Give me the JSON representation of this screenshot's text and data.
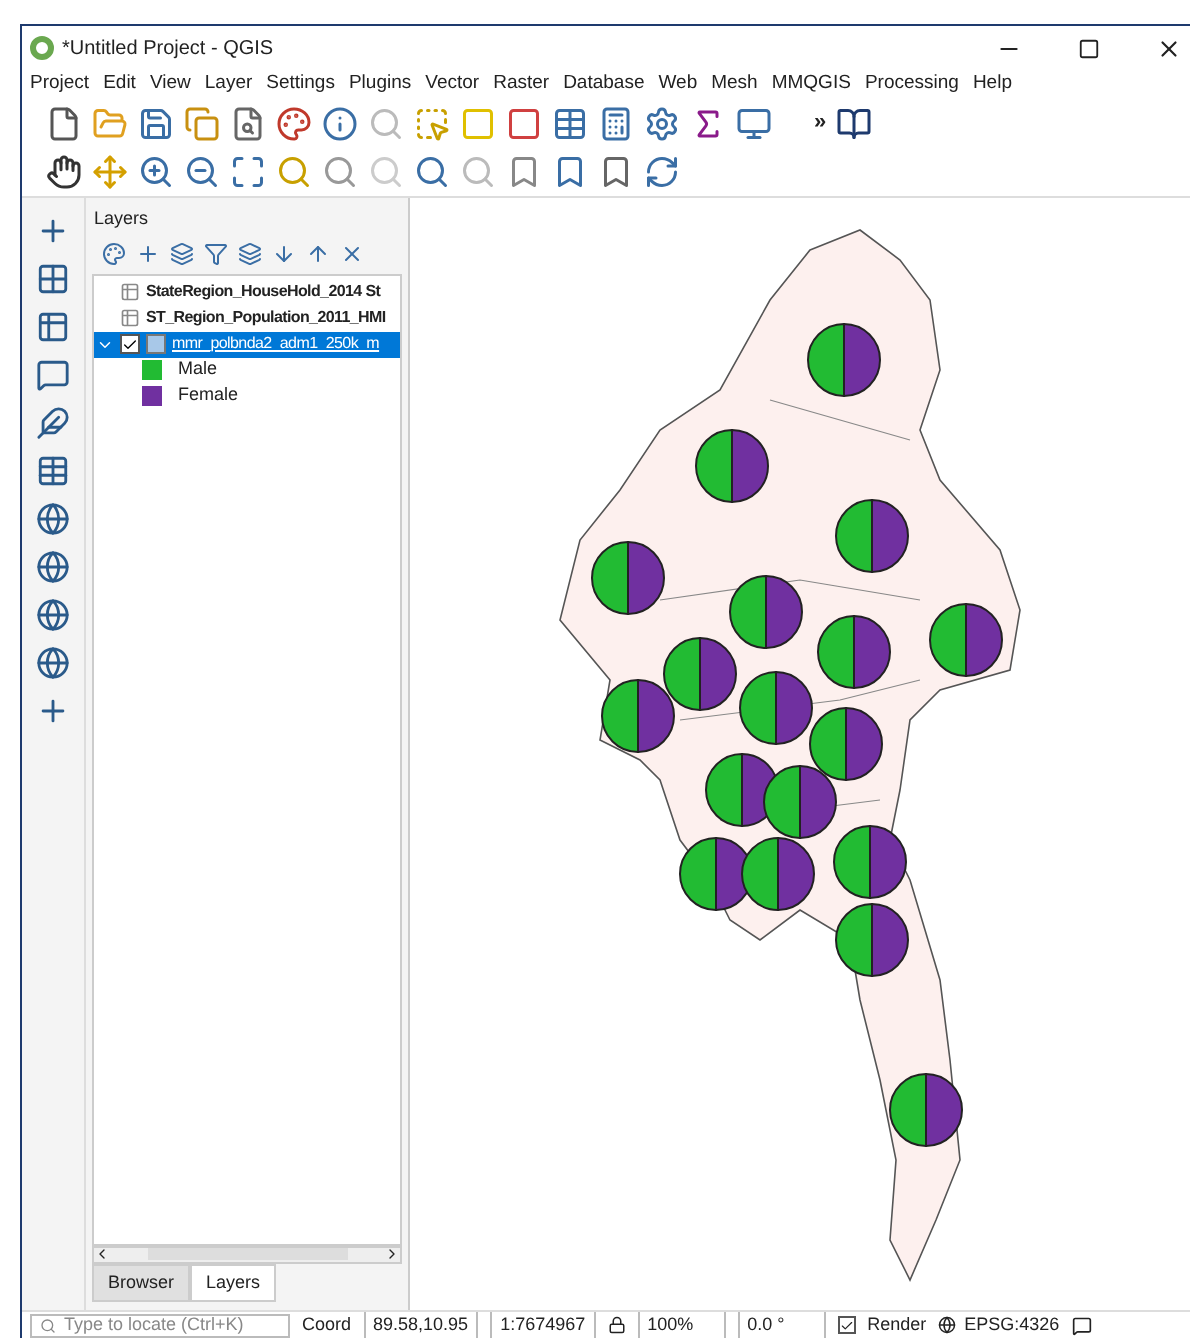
{
  "window": {
    "title": "*Untitled Project - QGIS"
  },
  "menu": [
    "Project",
    "Edit",
    "View",
    "Layer",
    "Settings",
    "Plugins",
    "Vector",
    "Raster",
    "Database",
    "Web",
    "Mesh",
    "MMQGIS",
    "Processing",
    "Help"
  ],
  "overflow": "»",
  "layers_panel": {
    "title": "Layers",
    "layers": [
      {
        "name": "StateRegion_HouseHold_2014 St",
        "kind": "table",
        "selected": false
      },
      {
        "name": "ST_Region_Population_2011_HMI",
        "kind": "table",
        "selected": false
      },
      {
        "name": "mmr_polbnda2_adm1_250k_m",
        "kind": "polygon",
        "selected": true,
        "expanded": true,
        "checked": true,
        "legend": [
          {
            "label": "Male",
            "color": "#22bb33"
          },
          {
            "label": "Female",
            "color": "#7030a0"
          }
        ]
      }
    ]
  },
  "panel_tabs": [
    {
      "label": "Browser",
      "selected": false
    },
    {
      "label": "Layers",
      "selected": true
    }
  ],
  "status_bar": {
    "locator": {
      "placeholder": "Type to locate (Ctrl+K)"
    },
    "coord_label": "Coord",
    "coordinate": "89.58,10.95",
    "scale": "1:7674967",
    "magnifier": "100%",
    "rotation": "0.0 °",
    "render": {
      "label": "Render",
      "checked": true
    },
    "crs": "EPSG:4326"
  }
}
